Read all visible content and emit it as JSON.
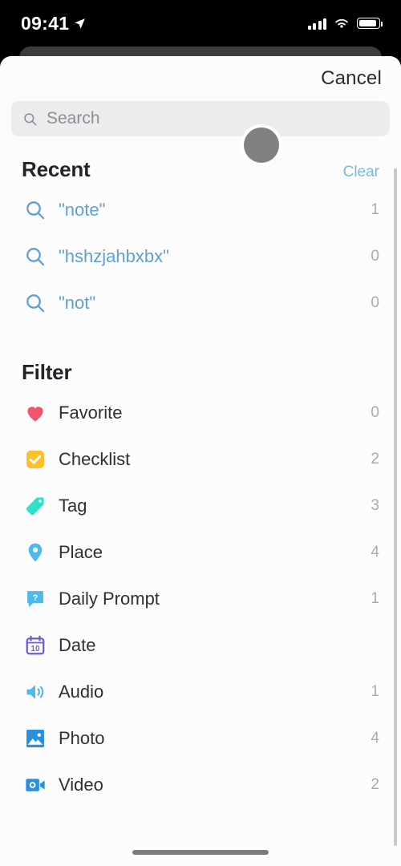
{
  "status_bar": {
    "time": "09:41",
    "location_icon": "location-arrow-icon",
    "cellular_icon": "cellular-bars-icon",
    "wifi_icon": "wifi-icon",
    "battery_icon": "battery-icon"
  },
  "sheet": {
    "cancel_label": "Cancel",
    "search": {
      "placeholder": "Search",
      "value": "",
      "icon": "search-icon"
    }
  },
  "recent": {
    "title": "Recent",
    "clear_label": "Clear",
    "items": [
      {
        "icon": "search-icon",
        "label": "\"note\"",
        "count": "1"
      },
      {
        "icon": "search-icon",
        "label": "\"hshzjahbxbx\"",
        "count": "0"
      },
      {
        "icon": "search-icon",
        "label": "\"not\"",
        "count": "0"
      }
    ]
  },
  "filter": {
    "title": "Filter",
    "items": [
      {
        "icon": "heart-icon",
        "label": "Favorite",
        "count": "0"
      },
      {
        "icon": "checklist-icon",
        "label": "Checklist",
        "count": "2"
      },
      {
        "icon": "tag-icon",
        "label": "Tag",
        "count": "3"
      },
      {
        "icon": "place-pin-icon",
        "label": "Place",
        "count": "4"
      },
      {
        "icon": "daily-prompt-icon",
        "label": "Daily Prompt",
        "count": "1"
      },
      {
        "icon": "calendar-icon",
        "label": "Date",
        "count": ""
      },
      {
        "icon": "audio-icon",
        "label": "Audio",
        "count": "1"
      },
      {
        "icon": "photo-icon",
        "label": "Photo",
        "count": "4"
      },
      {
        "icon": "video-icon",
        "label": "Video",
        "count": "2"
      }
    ]
  },
  "colors": {
    "heart": "#F2556B",
    "checklist": "#FBC02D",
    "tag": "#2EE0C8",
    "place": "#4EB8F0",
    "daily_prompt": "#4EB8F0",
    "calendar": "#6B5BD6",
    "audio": "#4EB8F0",
    "photo": "#2B8FE0",
    "video": "#2B8FE0",
    "recent_text": "#5F9FD4",
    "clear_link": "#7AB6DD",
    "count_text": "#A9AAAE",
    "sheet_bg": "#FCFCFD",
    "search_bg": "#ECECEE",
    "backdrop_card": "#3C3C3E"
  },
  "calendar_day": "10"
}
